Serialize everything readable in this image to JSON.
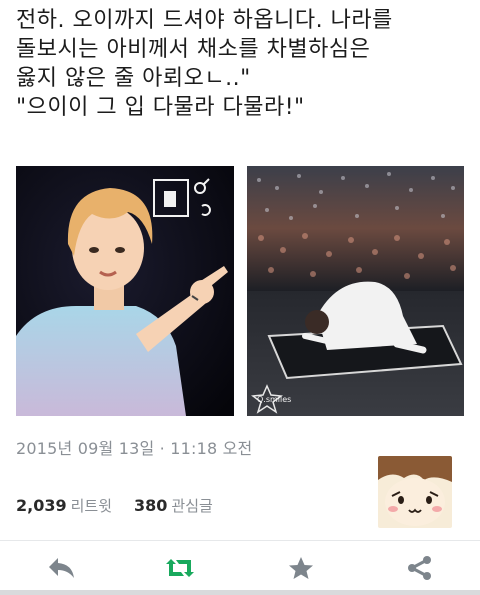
{
  "tweet": {
    "lines": [
      "전하. 오이까지 드셔야 하옵니다. 나라를",
      "돌보시는 아비께서 채소를 차별하심은",
      "옳지 않은 줄 아뢰오ㄴ..\"",
      "\"으이이 그 입 다물라 다물라!\""
    ],
    "timestamp": "2015년 09월 13일 · 11:18 오전",
    "retweets": {
      "count": "2,039",
      "label": "리트윗"
    },
    "likes": {
      "count": "380",
      "label": "관심글"
    }
  },
  "media": {
    "left_caption": "",
    "right_watermark": "Q.smiles"
  },
  "icons": {
    "reply": "reply-icon",
    "retweet": "retweet-icon",
    "favorite": "star-icon",
    "share": "share-icon"
  },
  "colors": {
    "text": "#1c1c1c",
    "muted": "#8a8f95",
    "retweet_green": "#19a95d",
    "icon_gray": "#7d858c"
  }
}
